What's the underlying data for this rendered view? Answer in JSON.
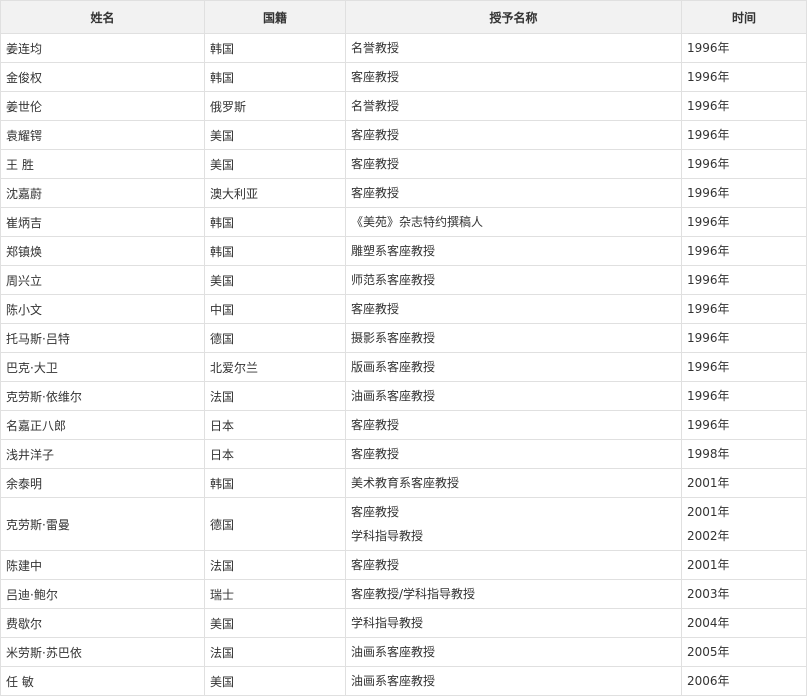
{
  "table": {
    "headers": [
      "姓名",
      "国籍",
      "授予名称",
      "时间"
    ],
    "rows": [
      {
        "name": "姜连均",
        "nation": "韩国",
        "title": [
          "名誉教授"
        ],
        "year": [
          "1996年"
        ]
      },
      {
        "name": "金俊权",
        "nation": "韩国",
        "title": [
          "客座教授"
        ],
        "year": [
          "1996年"
        ]
      },
      {
        "name": "姜世伦",
        "nation": "俄罗斯",
        "title": [
          "名誉教授"
        ],
        "year": [
          "1996年"
        ]
      },
      {
        "name": "袁耀锷",
        "nation": "美国",
        "title": [
          "客座教授"
        ],
        "year": [
          "1996年"
        ]
      },
      {
        "name": "王 胜",
        "nation": "美国",
        "title": [
          "客座教授"
        ],
        "year": [
          "1996年"
        ]
      },
      {
        "name": "沈嘉蔚",
        "nation": "澳大利亚",
        "title": [
          "客座教授"
        ],
        "year": [
          "1996年"
        ]
      },
      {
        "name": "崔炳吉",
        "nation": "韩国",
        "title": [
          "《美苑》杂志特约撰稿人"
        ],
        "year": [
          "1996年"
        ]
      },
      {
        "name": "郑镇焕",
        "nation": "韩国",
        "title": [
          "雕塑系客座教授"
        ],
        "year": [
          "1996年"
        ]
      },
      {
        "name": "周兴立",
        "nation": "美国",
        "title": [
          "师范系客座教授"
        ],
        "year": [
          "1996年"
        ]
      },
      {
        "name": "陈小文",
        "nation": "中国",
        "title": [
          "客座教授"
        ],
        "year": [
          "1996年"
        ]
      },
      {
        "name": "托马斯·吕特",
        "nation": "德国",
        "title": [
          "摄影系客座教授"
        ],
        "year": [
          "1996年"
        ]
      },
      {
        "name": "巴克·大卫",
        "nation": "北爱尔兰",
        "title": [
          "版画系客座教授"
        ],
        "year": [
          "1996年"
        ]
      },
      {
        "name": "克劳斯·依维尔",
        "nation": "法国",
        "title": [
          "油画系客座教授"
        ],
        "year": [
          "1996年"
        ]
      },
      {
        "name": "名嘉正八郎",
        "nation": "日本",
        "title": [
          "客座教授"
        ],
        "year": [
          "1996年"
        ]
      },
      {
        "name": "浅井洋子",
        "nation": "日本",
        "title": [
          "客座教授"
        ],
        "year": [
          "1998年"
        ]
      },
      {
        "name": "余泰明",
        "nation": "韩国",
        "title": [
          "美术教育系客座教授"
        ],
        "year": [
          "2001年"
        ]
      },
      {
        "name": "克劳斯·雷曼",
        "nation": "德国",
        "title": [
          "客座教授",
          "学科指导教授"
        ],
        "year": [
          "2001年",
          "2002年"
        ]
      },
      {
        "name": "陈建中",
        "nation": "法国",
        "title": [
          "客座教授"
        ],
        "year": [
          "2001年"
        ]
      },
      {
        "name": "吕迪·鲍尔",
        "nation": "瑞士",
        "title": [
          "客座教授/学科指导教授"
        ],
        "year": [
          "2003年"
        ]
      },
      {
        "name": "费歇尔",
        "nation": "美国",
        "title": [
          "学科指导教授"
        ],
        "year": [
          "2004年"
        ]
      },
      {
        "name": "米劳斯·苏巴依",
        "nation": "法国",
        "title": [
          "油画系客座教授"
        ],
        "year": [
          "2005年"
        ]
      },
      {
        "name": "任 敏",
        "nation": "美国",
        "title": [
          "油画系客座教授"
        ],
        "year": [
          "2006年"
        ]
      }
    ]
  }
}
